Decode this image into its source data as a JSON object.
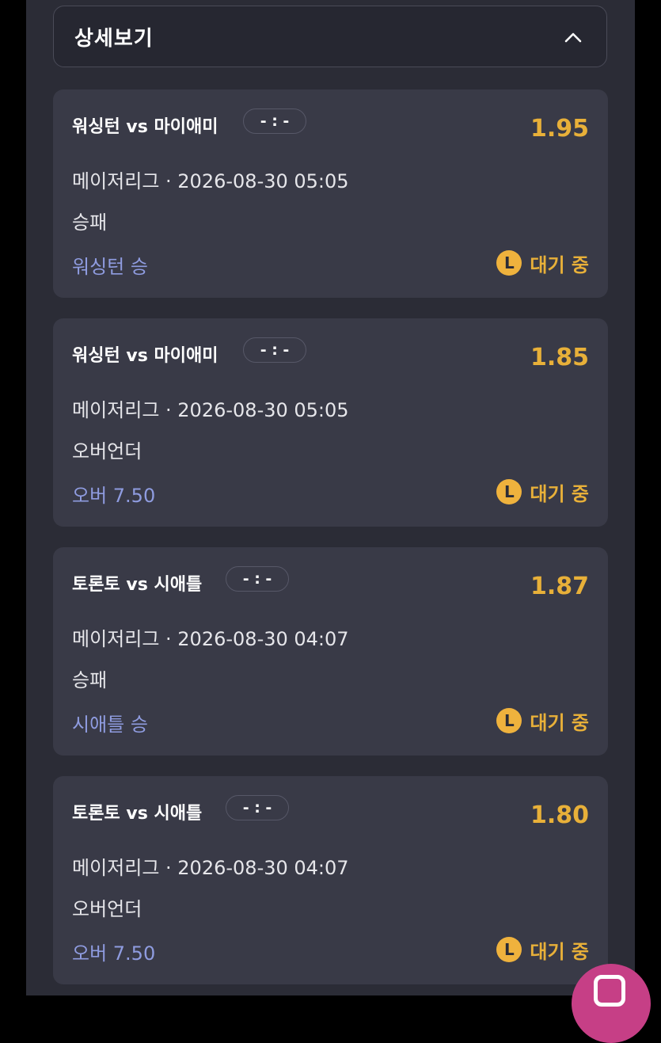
{
  "detail_section": {
    "title": "상세보기",
    "toggle_icon": "chevron-up-icon"
  },
  "bets": [
    {
      "match": "워싱턴 vs 마이애미",
      "score": "- : -",
      "odds": "1.95",
      "meta": "메이저리그 · 2026-08-30 05:05",
      "market": "승패",
      "pick": "워싱턴 승",
      "status_icon": "L",
      "status": "대기 중"
    },
    {
      "match": "워싱턴 vs 마이애미",
      "score": "- : -",
      "odds": "1.85",
      "meta": "메이저리그 · 2026-08-30 05:05",
      "market": "오버언더",
      "pick": "오버 7.50",
      "status_icon": "L",
      "status": "대기 중"
    },
    {
      "match": "토론토 vs 시애틀",
      "score": "- : -",
      "odds": "1.87",
      "meta": "메이저리그 · 2026-08-30 04:07",
      "market": "승패",
      "pick": "시애틀 승",
      "status_icon": "L",
      "status": "대기 중"
    },
    {
      "match": "토론토 vs 시애틀",
      "score": "- : -",
      "odds": "1.80",
      "meta": "메이저리그 · 2026-08-30 04:07",
      "market": "오버언더",
      "pick": "오버 7.50",
      "status_icon": "L",
      "status": "대기 중"
    }
  ],
  "colors": {
    "odds": "#e8b039",
    "pick": "#8f9ce0",
    "card_bg": "#393a47",
    "fab": "#c63f86"
  }
}
